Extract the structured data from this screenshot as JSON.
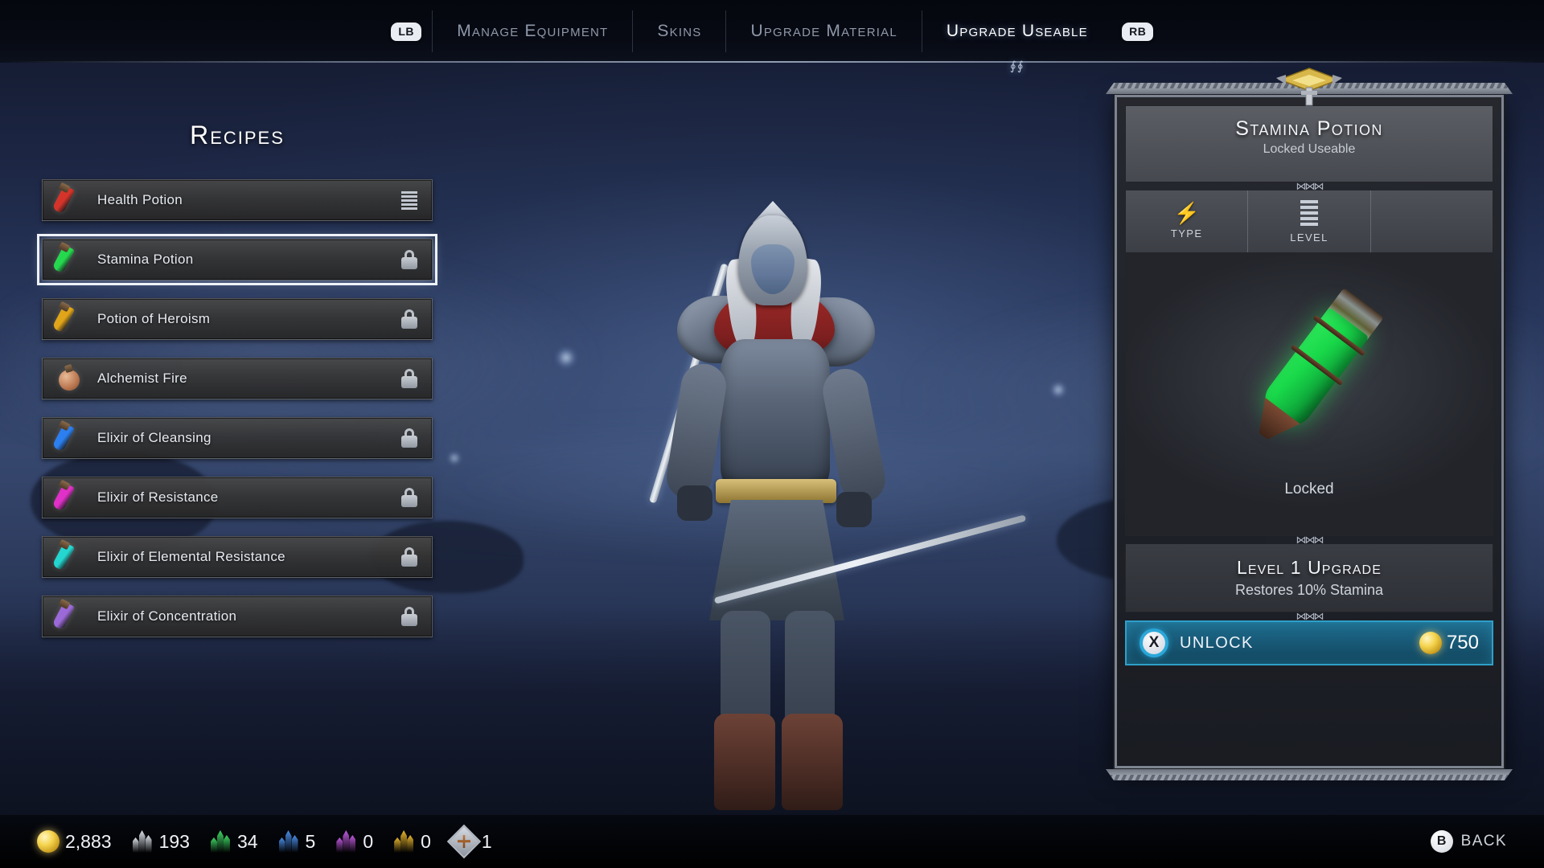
{
  "topbar": {
    "left_bumper": "LB",
    "right_bumper": "RB",
    "tabs": [
      {
        "label": "Manage Equipment",
        "active": false
      },
      {
        "label": "Skins",
        "active": false
      },
      {
        "label": "Upgrade Material",
        "active": false
      },
      {
        "label": "Upgrade Useable",
        "active": true
      }
    ]
  },
  "recipes": {
    "title": "Recipes",
    "items": [
      {
        "label": "Health Potion",
        "color": "#d6342a",
        "icon": "potion-icon",
        "right": "level-bars"
      },
      {
        "label": "Stamina Potion",
        "color": "#25d94f",
        "icon": "potion-icon",
        "right": "lock-icon",
        "selected": true
      },
      {
        "label": "Potion of Heroism",
        "color": "#e0a519",
        "icon": "potion-icon",
        "right": "lock-icon"
      },
      {
        "label": "Alchemist Fire",
        "color": "#c67a4e",
        "icon": "flask-icon",
        "right": "lock-icon"
      },
      {
        "label": "Elixir of Cleansing",
        "color": "#2b7ff0",
        "icon": "potion-icon",
        "right": "lock-icon"
      },
      {
        "label": "Elixir of Resistance",
        "color": "#e030c8",
        "icon": "potion-icon",
        "right": "lock-icon"
      },
      {
        "label": "Elixir of Elemental Resistance",
        "color": "#24d6d0",
        "icon": "potion-icon",
        "right": "lock-icon"
      },
      {
        "label": "Elixir of Concentration",
        "color": "#9b6ad8",
        "icon": "potion-icon",
        "right": "lock-icon"
      }
    ]
  },
  "detail": {
    "title": "Stamina Potion",
    "subtitle": "Locked Useable",
    "stats": [
      {
        "label": "TYPE",
        "icon": "lightning-bolt-icon"
      },
      {
        "label": "LEVEL",
        "icon": "level-bars-icon"
      }
    ],
    "item_status": "Locked",
    "upgrade_title": "Level 1 Upgrade",
    "upgrade_desc": "Restores 10% Stamina",
    "unlock": {
      "button_glyph": "X",
      "label": "UNLOCK",
      "price": "750",
      "currency_icon": "gold-coin-icon"
    }
  },
  "bottombar": {
    "currencies": [
      {
        "name": "gold",
        "value": "2,883",
        "icon": "gold-coin-icon",
        "color": "#f0c73a"
      },
      {
        "name": "white-crystal",
        "value": "193",
        "icon": "crystal-icon",
        "color": "#dfe4ec"
      },
      {
        "name": "green-crystal",
        "value": "34",
        "icon": "crystal-icon",
        "color": "#3fd763"
      },
      {
        "name": "blue-crystal",
        "value": "5",
        "icon": "crystal-icon",
        "color": "#4a8de8"
      },
      {
        "name": "purple-crystal",
        "value": "0",
        "icon": "crystal-icon",
        "color": "#c259e0"
      },
      {
        "name": "yellow-crystal",
        "value": "0",
        "icon": "crystal-icon",
        "color": "#e8b52c"
      },
      {
        "name": "token",
        "value": "1",
        "icon": "diamond-emblem-icon",
        "color": "#c07a3c"
      }
    ],
    "back": {
      "glyph": "B",
      "label": "BACK"
    }
  },
  "colors": {
    "accent_blue": "#2ea0c9",
    "selection_white": "#eef2f8",
    "panel_gray": "#46494f",
    "gold": "#f5d44f"
  }
}
